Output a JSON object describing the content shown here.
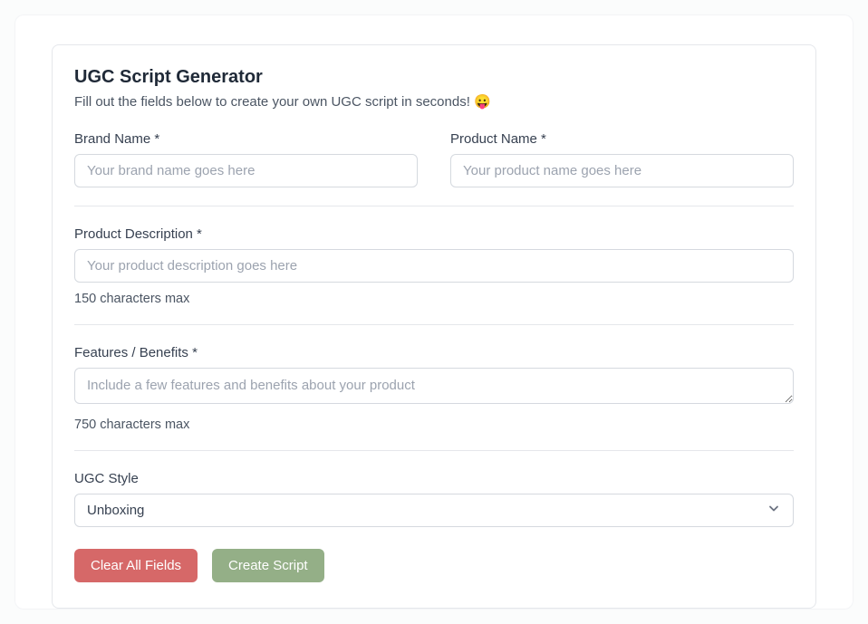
{
  "header": {
    "title": "UGC Script Generator",
    "subtitle": "Fill out the fields below to create your own UGC script in seconds! 😛"
  },
  "fields": {
    "brand": {
      "label": "Brand Name *",
      "placeholder": "Your brand name goes here",
      "value": ""
    },
    "product": {
      "label": "Product Name *",
      "placeholder": "Your product name goes here",
      "value": ""
    },
    "description": {
      "label": "Product Description *",
      "placeholder": "Your product description goes here",
      "value": "",
      "helper": "150 characters max"
    },
    "features": {
      "label": "Features / Benefits *",
      "placeholder": "Include a few features and benefits about your product",
      "value": "",
      "helper": "750  characters max"
    },
    "style": {
      "label": "UGC Style",
      "selected": "Unboxing"
    }
  },
  "buttons": {
    "clear": "Clear All Fields",
    "create": "Create Script"
  }
}
